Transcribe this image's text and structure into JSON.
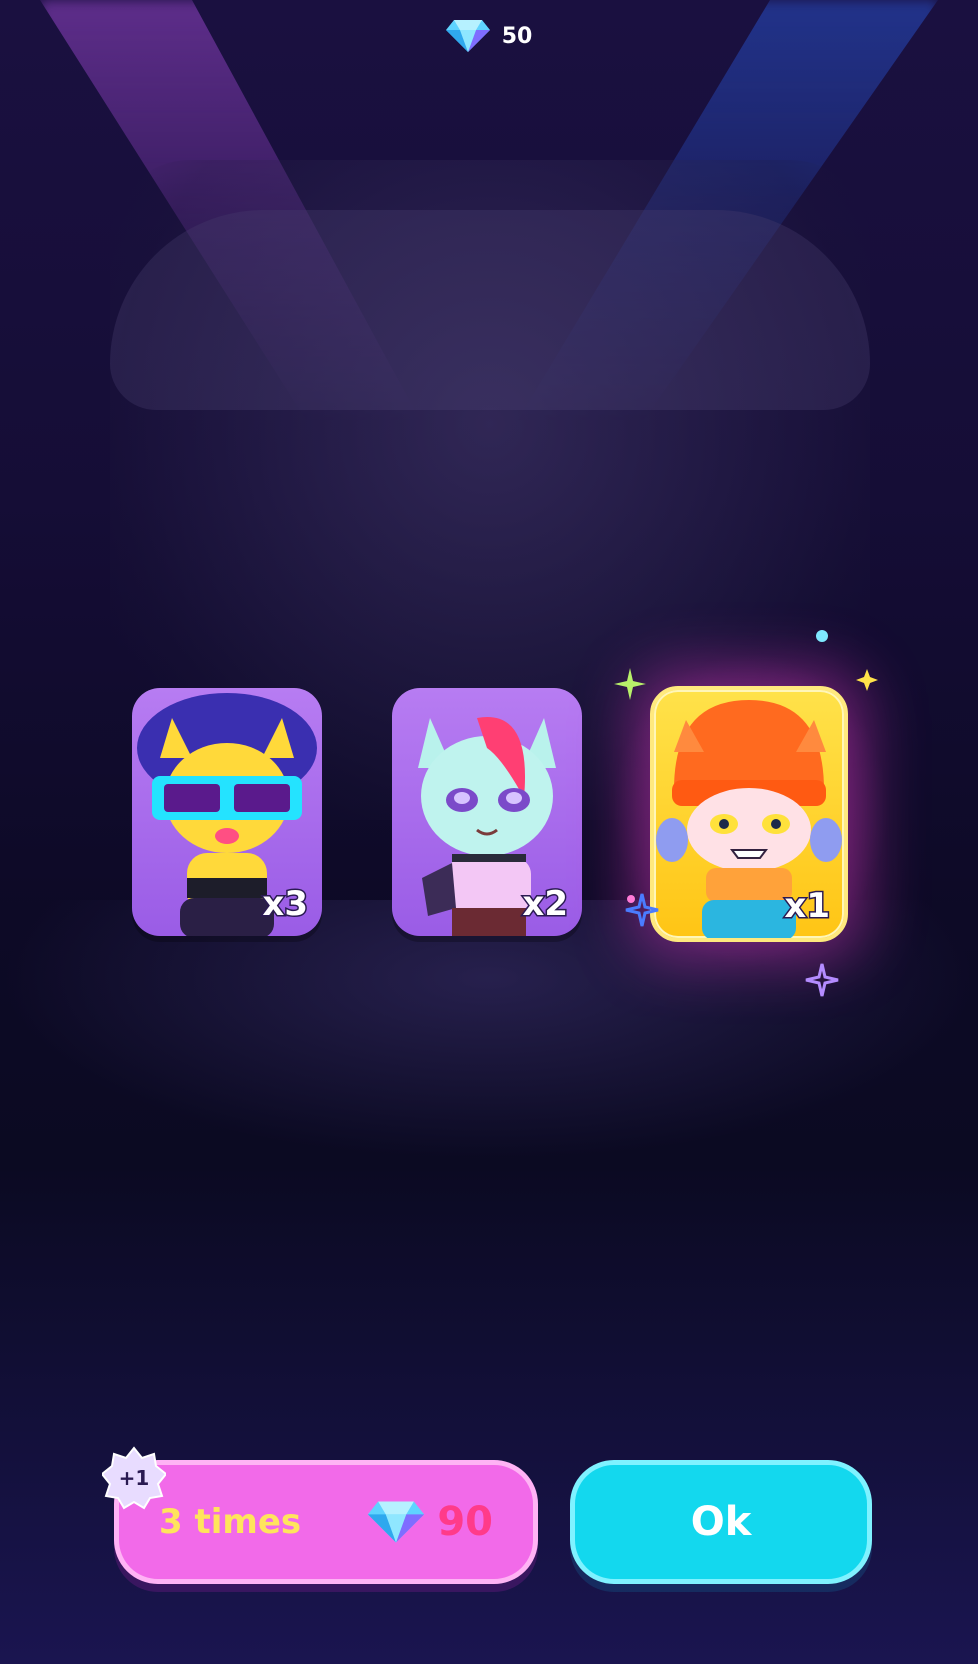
{
  "hud": {
    "currency_icon": "diamond-gem-icon",
    "currency_value": "50"
  },
  "reveal": {
    "cards": [
      {
        "name": "dj-cat-with-led-glasses",
        "count": "x3",
        "background": "#b77cf2",
        "highlighted": false
      },
      {
        "name": "punk-cat-with-pink-hair",
        "count": "x2",
        "background": "#b77cf2",
        "highlighted": false
      },
      {
        "name": "beanie-cat-girl",
        "count": "x1",
        "background": "#ffd629",
        "highlighted": true
      }
    ]
  },
  "actions": {
    "multi_pull": {
      "bonus_badge": "+1",
      "label": "3 times",
      "price_icon": "diamond-gem-icon",
      "price": "90",
      "color": "#f26ae9"
    },
    "ok": {
      "label": "Ok",
      "color": "#13d8ee"
    }
  }
}
